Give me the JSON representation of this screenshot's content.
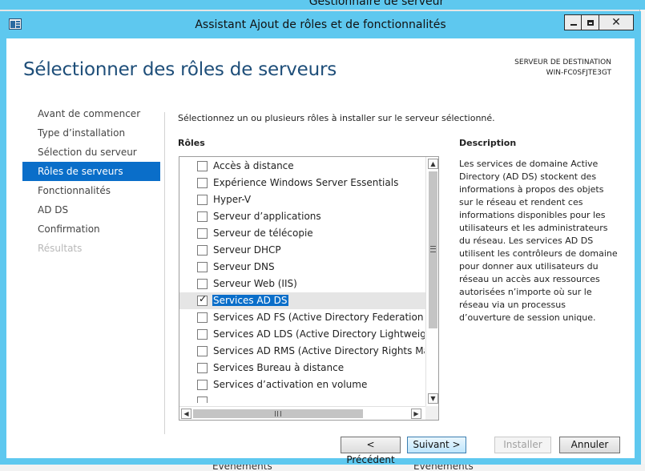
{
  "background": {
    "title": "Gestionnaire de serveur",
    "bottom_labels": [
      "Événements",
      "Événements"
    ]
  },
  "window": {
    "title": "Assistant Ajout de rôles et de fonctionnalités",
    "accent_color": "#5ec8ef"
  },
  "page": {
    "title": "Sélectionner des rôles de serveurs",
    "destination_label": "SERVEUR DE DESTINATION",
    "destination_name": "WIN-FC0SFJTE3GT"
  },
  "nav": {
    "items": [
      {
        "label": "Avant de commencer",
        "state": "normal"
      },
      {
        "label": "Type d’installation",
        "state": "normal"
      },
      {
        "label": "Sélection du serveur",
        "state": "normal"
      },
      {
        "label": "Rôles de serveurs",
        "state": "active"
      },
      {
        "label": "Fonctionnalités",
        "state": "normal"
      },
      {
        "label": "AD DS",
        "state": "normal"
      },
      {
        "label": "Confirmation",
        "state": "normal"
      },
      {
        "label": "Résultats",
        "state": "disabled"
      }
    ]
  },
  "roles": {
    "instruction": "Sélectionnez un ou plusieurs rôles à installer sur le serveur sélectionné.",
    "heading": "Rôles",
    "items": [
      {
        "label": "Accès à distance",
        "checked": false
      },
      {
        "label": "Expérience Windows Server Essentials",
        "checked": false
      },
      {
        "label": "Hyper-V",
        "checked": false
      },
      {
        "label": "Serveur d’applications",
        "checked": false
      },
      {
        "label": "Serveur de télécopie",
        "checked": false
      },
      {
        "label": "Serveur DHCP",
        "checked": false
      },
      {
        "label": "Serveur DNS",
        "checked": false
      },
      {
        "label": "Serveur Web (IIS)",
        "checked": false
      },
      {
        "label": "Services AD DS",
        "checked": true,
        "selected": true
      },
      {
        "label": "Services AD FS (Active Directory Federation Services)",
        "checked": false
      },
      {
        "label": "Services AD LDS (Active Directory Lightweight Directory Services)",
        "checked": false
      },
      {
        "label": "Services AD RMS (Active Directory Rights Management Services)",
        "checked": false
      },
      {
        "label": "Services Bureau à distance",
        "checked": false
      },
      {
        "label": "Services d’activation en volume",
        "checked": false
      }
    ]
  },
  "description": {
    "heading": "Description",
    "text": "Les services de domaine Active Directory (AD DS) stockent des informations à propos des objets sur le réseau et rendent ces informations disponibles pour les utilisateurs et les administrateurs du réseau. Les services AD DS utilisent les contrôleurs de domaine pour donner aux utilisateurs du réseau un accès aux ressources autorisées n’importe où sur le réseau via un processus d’ouverture de session unique."
  },
  "buttons": {
    "previous": "< Précédent",
    "next": "Suivant >",
    "install": "Installer",
    "cancel": "Annuler"
  }
}
